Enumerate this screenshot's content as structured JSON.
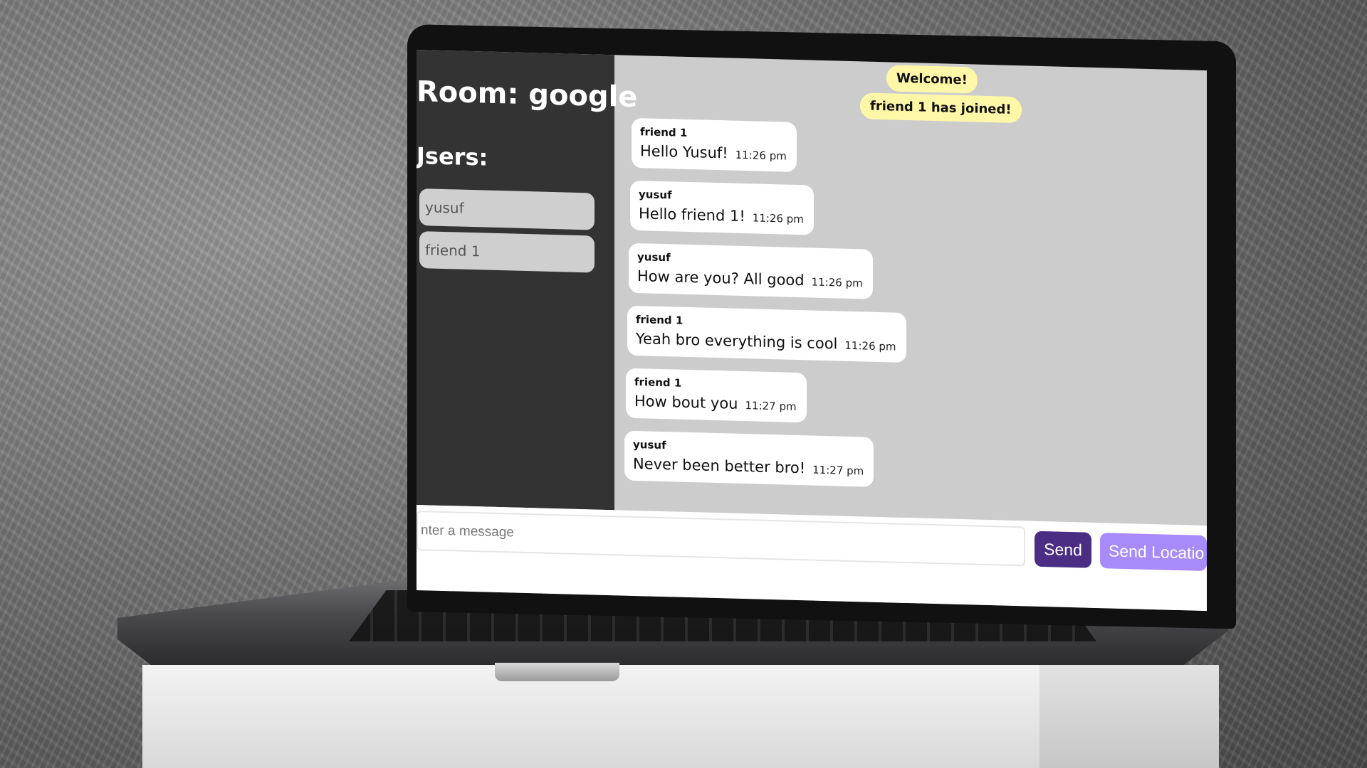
{
  "sidebar": {
    "room_title": "Room: google",
    "users_title": "Jsers:",
    "users": [
      "yusuf",
      "friend 1"
    ]
  },
  "chat": {
    "banners": [
      "Welcome!",
      "friend 1 has joined!"
    ],
    "messages": [
      {
        "author": "friend 1",
        "text": "Hello Yusuf!",
        "time": "11:26 pm"
      },
      {
        "author": "yusuf",
        "text": "Hello friend 1!",
        "time": "11:26 pm"
      },
      {
        "author": "yusuf",
        "text": "How are you? All good",
        "time": "11:26 pm"
      },
      {
        "author": "friend 1",
        "text": "Yeah bro everything is cool",
        "time": "11:26 pm"
      },
      {
        "author": "friend 1",
        "text": "How bout you",
        "time": "11:27 pm"
      },
      {
        "author": "yusuf",
        "text": "Never been better bro!",
        "time": "11:27 pm"
      }
    ]
  },
  "composer": {
    "placeholder": "nter a message",
    "send_label": "Send",
    "location_label": "Send Locatio"
  },
  "colors": {
    "sidebar_bg": "#333333",
    "chat_bg": "#cccccc",
    "banner_bg": "#fff7a8",
    "send_button": "#4b2e83",
    "location_button": "#a78bfa"
  }
}
